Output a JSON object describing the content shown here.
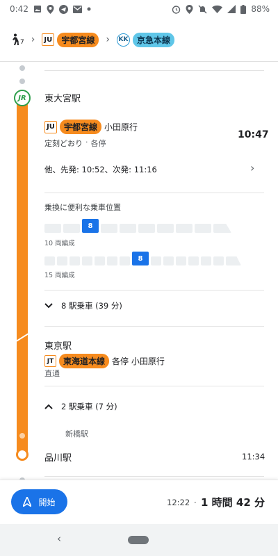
{
  "status_bar": {
    "time": "0:42",
    "battery": "88%"
  },
  "route": {
    "walk_minutes": "7",
    "leg1": {
      "code": "JU",
      "name": "宇都宮線"
    },
    "leg2": {
      "code": "KK",
      "name": "京急本線"
    }
  },
  "segment1": {
    "operator_logo": "JR",
    "station": "東大宮駅",
    "line_code": "JU",
    "line_name": "宇都宮線",
    "destination": "小田原行",
    "status": "定刻どおり",
    "service": "各停",
    "departure_time": "10:47",
    "other_departures": "他、先発: 10:52、次発: 11:16",
    "boarding_title": "乗換に便利な乗車位置",
    "train10": {
      "selected_car": "8",
      "label": "10 両編成"
    },
    "train15": {
      "selected_car": "8",
      "label": "15 両編成"
    },
    "ride": "8 駅乗車 (39 分)"
  },
  "segment2": {
    "station": "東京駅",
    "line_code": "JT",
    "line_name": "東海道本線",
    "service_dest": "各停 小田原行",
    "through": "直通",
    "ride": "2 駅乗車 (7 分)",
    "intermediate": "新橋駅",
    "arrival_station": "品川駅",
    "arrival_time": "11:34"
  },
  "bottom": {
    "start_label": "開始",
    "arrival": "12:22",
    "duration": "1 時間 42 分"
  },
  "colors": {
    "jr_orange": "#f68b1e",
    "keikyu_blue": "#5fc6e8",
    "accent": "#1a73e8"
  }
}
